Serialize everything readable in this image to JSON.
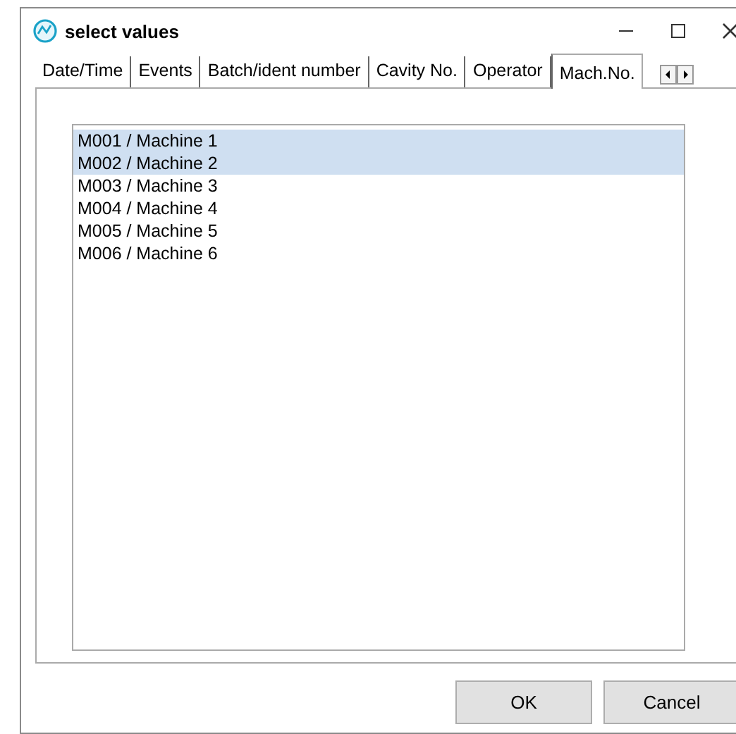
{
  "window": {
    "title": "select values"
  },
  "tabs": [
    {
      "label": "Date/Time",
      "selected": false
    },
    {
      "label": "Events",
      "selected": false
    },
    {
      "label": "Batch/ident number",
      "selected": false
    },
    {
      "label": "Cavity No.",
      "selected": false
    },
    {
      "label": "Operator",
      "selected": false
    },
    {
      "label": "Mach.No.",
      "selected": true
    }
  ],
  "list": [
    {
      "label": "M001 / Machine 1",
      "selected": true
    },
    {
      "label": "M002 / Machine 2",
      "selected": true
    },
    {
      "label": "M003 / Machine 3",
      "selected": false
    },
    {
      "label": "M004 / Machine 4",
      "selected": false
    },
    {
      "label": "M005 / Machine 5",
      "selected": false
    },
    {
      "label": "M006 / Machine 6",
      "selected": false
    }
  ],
  "buttons": [
    "OK",
    "Cancel"
  ]
}
